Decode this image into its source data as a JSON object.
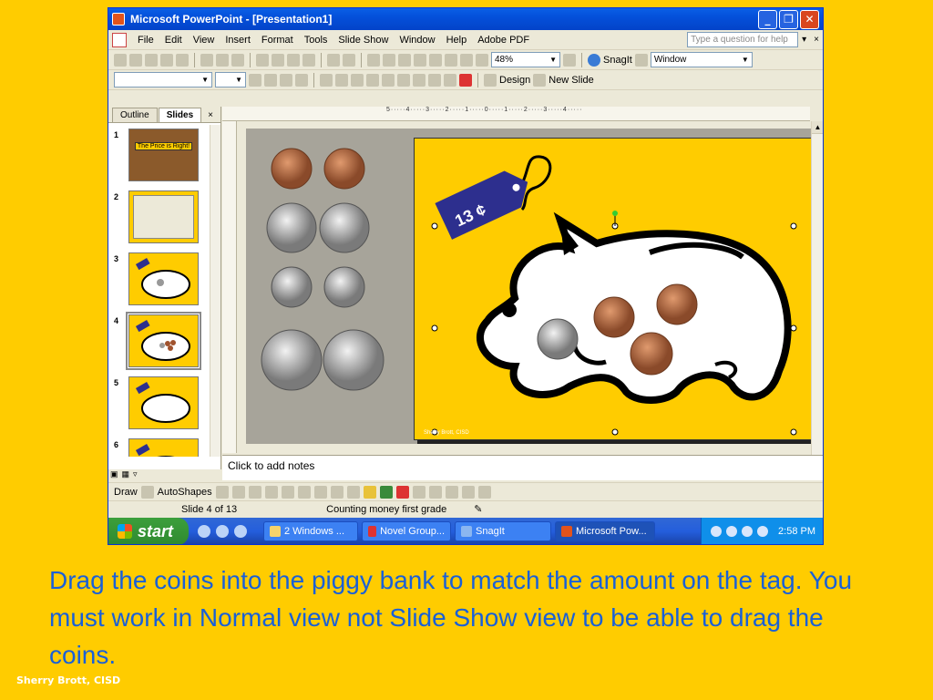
{
  "window": {
    "title": "Microsoft PowerPoint - [Presentation1]",
    "minimize": "_",
    "restore": "❐",
    "close": "✕"
  },
  "menu": {
    "items": [
      "File",
      "Edit",
      "View",
      "Insert",
      "Format",
      "Tools",
      "Slide Show",
      "Window",
      "Help",
      "Adobe PDF"
    ],
    "help_placeholder": "Type a question for help"
  },
  "toolbar": {
    "zoom": "48%",
    "snagit": "SnagIt",
    "window_combo": "Window",
    "design": "Design",
    "new_slide": "New Slide"
  },
  "panes": {
    "tab_outline": "Outline",
    "tab_slides": "Slides",
    "close": "×"
  },
  "slides": [
    {
      "num": "1",
      "title": "The Price is Right!"
    },
    {
      "num": "2"
    },
    {
      "num": "3"
    },
    {
      "num": "4"
    },
    {
      "num": "5"
    },
    {
      "num": "6"
    }
  ],
  "ruler": "5·····4·····3·····2·····1·····0·····1·····2·····3·····4·····",
  "slide": {
    "price_tag": "13 ¢",
    "credit": "Sherry Brott, CISD"
  },
  "notes": "Click to add notes",
  "drawbar": {
    "draw": "Draw",
    "autoshapes": "AutoShapes"
  },
  "status": {
    "slide_of": "Slide 4 of 13",
    "design": "Counting money  first grade"
  },
  "taskbar": {
    "start": "start",
    "tasks": [
      "2 Windows ...",
      "Novel Group...",
      "SnagIt",
      "Microsoft Pow..."
    ],
    "clock": "2:58 PM"
  },
  "caption": "Drag the coins into the piggy bank to match the amount on the tag. You must work in Normal view not Slide Show view to be able to drag the coins.",
  "author": "Sherry Brott, CISD"
}
